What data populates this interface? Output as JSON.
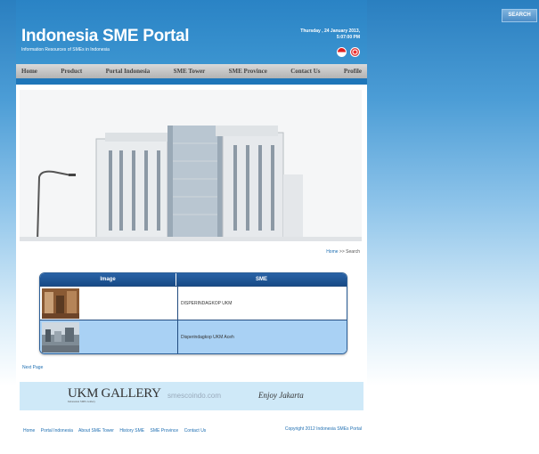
{
  "search": {
    "label": "SEARCH"
  },
  "header": {
    "title": "Indonesia SME Portal",
    "tagline": "Information Resources of SMEs in Indonesia",
    "date": "Thursday , 24 January 2013,",
    "time": "5:07:00 PM"
  },
  "nav": {
    "items": [
      {
        "label": "Home"
      },
      {
        "label": "Product"
      },
      {
        "label": "Portal Indonesia"
      },
      {
        "label": "SME Tower"
      },
      {
        "label": "SME Province"
      },
      {
        "label": "Contact Us"
      },
      {
        "label": "Profile"
      }
    ]
  },
  "breadcrumb": {
    "home": "Home",
    "sep": ">>",
    "current": "Search"
  },
  "table": {
    "headers": {
      "image": "Image",
      "sme": "SME"
    },
    "rows": [
      {
        "sme": "DISPERINDAGKOP UKM"
      },
      {
        "sme": "Disperindagkop UKM Aceh"
      }
    ]
  },
  "pagination": {
    "next": "Next Page"
  },
  "partners": {
    "gallery": "UKM GALLERY",
    "gallery_sub": "Indonesian SMEs Gallery",
    "smescoindo": "smescoindo.com",
    "enjoy": "Enjoy Jakarta",
    "enjoy_hl": "Jakarta"
  },
  "footer": {
    "links": [
      {
        "label": "Home"
      },
      {
        "label": "Portal Indonesia"
      },
      {
        "label": "About SME Tower"
      },
      {
        "label": "History SME"
      },
      {
        "label": "SME Province"
      },
      {
        "label": "Contact Us"
      }
    ],
    "copyright": "Copyright 2012 Indonesia SMEs Portal"
  },
  "colors": {
    "brand_blue": "#2a83c5",
    "table_header": "#1f4f8c",
    "row_alt": "#a9d1f4"
  }
}
